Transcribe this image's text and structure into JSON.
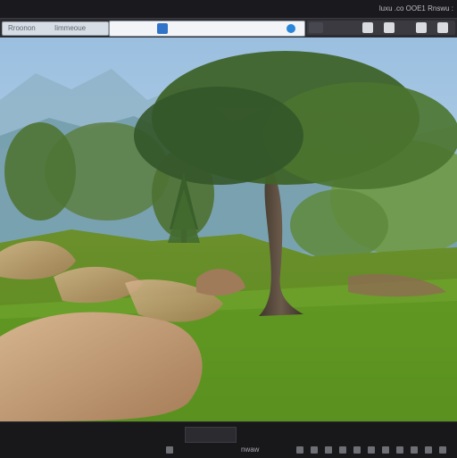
{
  "top_status": "luxu  .co  OOE1  Rnswu  :",
  "tabs": {
    "left_a": "Rroonon",
    "left_b": "Iimmeoue"
  },
  "address_text": "",
  "timeline_time": "",
  "bottom_label": "nwaw",
  "colors": {
    "ui_dark": "#141416",
    "sky": "#a9c9e5",
    "grass": "#6f9b2f",
    "trunk": "#5a4b3d",
    "rock": "#c9a37a"
  },
  "icons": [
    "square-icon",
    "search-icon",
    "app-icon",
    "play-icon",
    "settings-icon"
  ]
}
